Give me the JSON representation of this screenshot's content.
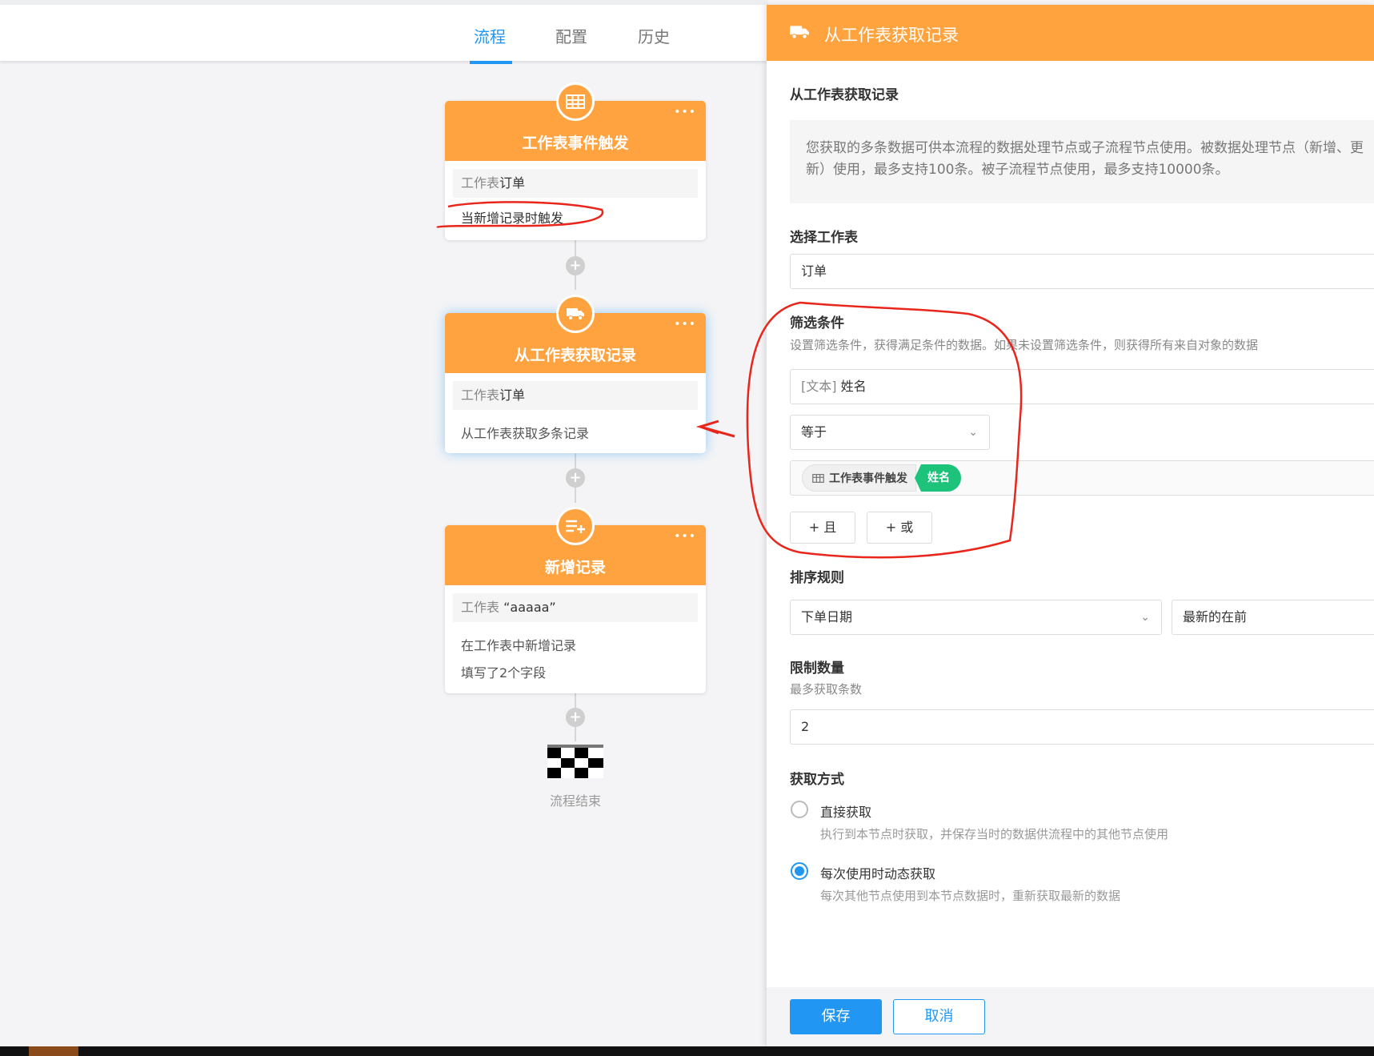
{
  "tabs": [
    {
      "label": "流程",
      "active": true
    },
    {
      "label": "配置",
      "active": false
    },
    {
      "label": "历史",
      "active": false
    }
  ],
  "nodes": {
    "trigger": {
      "title": "工作表事件触发",
      "menu": "•••",
      "worksheet_prefix": "工作表",
      "worksheet_name": "订单",
      "description": "当新增记录时触发"
    },
    "fetch": {
      "title": "从工作表获取记录",
      "menu": "•••",
      "worksheet_prefix": "工作表",
      "worksheet_name": "订单",
      "description": "从工作表获取多条记录"
    },
    "add": {
      "title": "新增记录",
      "menu": "•••",
      "worksheet_prefix": "工作表",
      "worksheet_name": "“aaaaa”",
      "description": "在工作表中新增记录",
      "fields": "填写了2个字段"
    }
  },
  "end_label": "流程结束",
  "panel": {
    "header_title": "从工作表获取记录",
    "section_title": "从工作表获取记录",
    "info": "您获取的多条数据可供本流程的数据处理节点或子流程节点使用。被数据处理节点（新增、更新）使用，最多支持100条。被子流程节点使用，最多支持10000条。",
    "select_sheet": {
      "label": "选择工作表",
      "value": "订单"
    },
    "filter": {
      "label": "筛选条件",
      "description": "设置筛选条件，获得满足条件的数据。如果未设置筛选条件，则获得所有来自对象的数据",
      "field_type": "[文本]",
      "field_name": "姓名",
      "operator": "等于",
      "chip_source": "工作表事件触发",
      "chip_field": "姓名",
      "and_button": "+ 且",
      "or_button": "+ 或"
    },
    "sort": {
      "label": "排序规则",
      "field": "下单日期",
      "order": "最新的在前"
    },
    "limit": {
      "label": "限制数量",
      "sub": "最多获取条数",
      "value": "2"
    },
    "mode": {
      "label": "获取方式",
      "options": [
        {
          "label": "直接获取",
          "desc": "执行到本节点时获取，并保存当时的数据供流程中的其他节点使用",
          "selected": false
        },
        {
          "label": "每次使用时动态获取",
          "desc": "每次其他节点使用到本节点数据时，重新获取最新的数据",
          "selected": true
        }
      ]
    },
    "save_label": "保存",
    "cancel_label": "取消"
  },
  "colors": {
    "node_orange": "#ffa340",
    "primary_blue": "#2196f3",
    "chip_green": "#1dc37a",
    "annotation_red": "#e8261c"
  }
}
